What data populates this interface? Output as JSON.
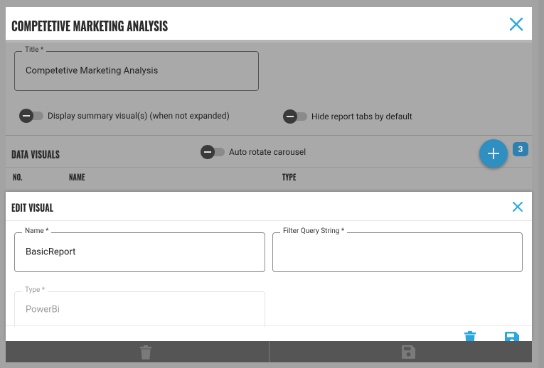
{
  "outer_dialog": {
    "title": "COMPETETIVE MARKETING ANALYSIS",
    "title_field": {
      "label": "Title *",
      "value": "Competetive Marketing Analysis"
    },
    "toggles": {
      "display_summary": {
        "label": "Display summary visual(s) (when not expanded)",
        "on": false
      },
      "hide_report_tabs": {
        "label": "Hide report tabs by default",
        "on": false
      }
    }
  },
  "data_visuals": {
    "title": "DATA VISUALS",
    "auto_rotate": {
      "label": "Auto rotate carousel",
      "on": false
    },
    "count": "3",
    "columns": [
      "NO.",
      "NAME",
      "TYPE"
    ]
  },
  "edit_visual": {
    "title": "EDIT VISUAL",
    "name_field": {
      "label": "Name *",
      "value": "BasicReport"
    },
    "filter_field": {
      "label": "Filter Query String *",
      "value": ""
    },
    "type_field": {
      "label": "Type *",
      "value": "PowerBi"
    }
  },
  "colors": {
    "accent": "#29a8e0",
    "dim_overlay": "#a9a9a9",
    "footer": "#555555"
  },
  "icons": [
    "close-icon",
    "add-icon",
    "delete-icon",
    "save-icon"
  ]
}
